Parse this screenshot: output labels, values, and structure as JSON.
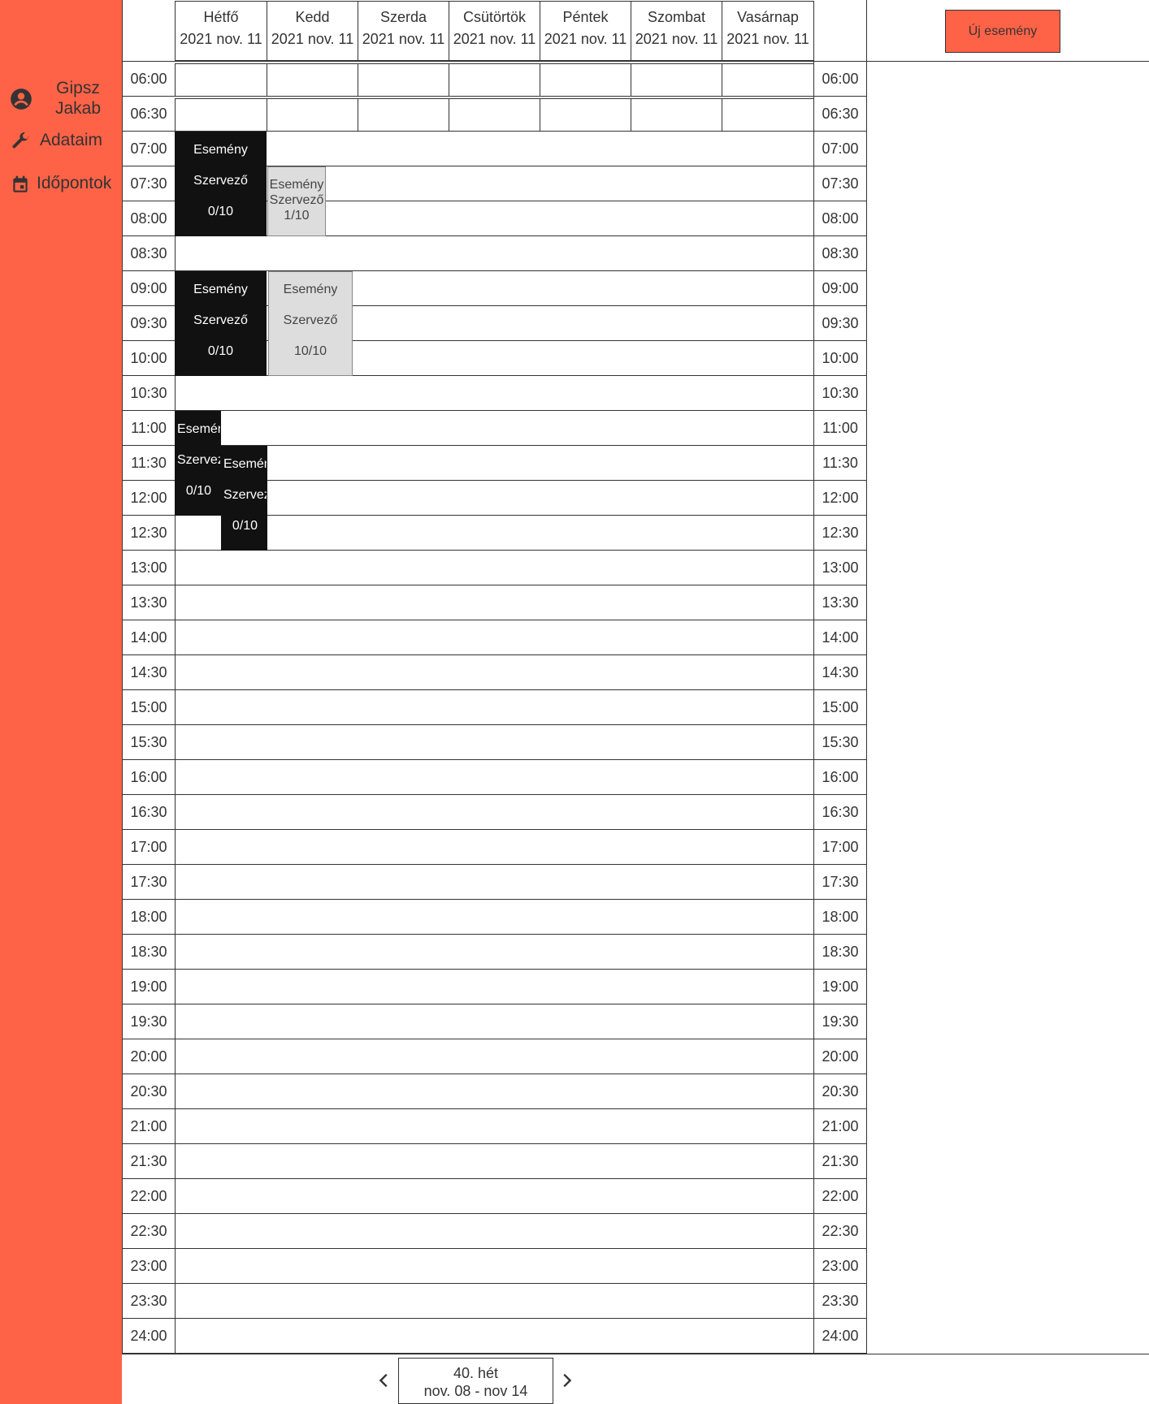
{
  "sidebar": {
    "user_name": "Gipsz Jakab",
    "user_icon": "account-circle-icon",
    "links": [
      {
        "label": "Adataim",
        "icon": "wrench-icon"
      },
      {
        "label": "Időpontok",
        "icon": "calendar-icon"
      }
    ]
  },
  "header": {
    "new_event_label": "Új esemény"
  },
  "days": [
    {
      "name": "Hétfő",
      "date": "2021 nov. 11"
    },
    {
      "name": "Kedd",
      "date": "2021 nov. 11"
    },
    {
      "name": "Szerda",
      "date": "2021 nov. 11"
    },
    {
      "name": "Csütörtök",
      "date": "2021 nov. 11"
    },
    {
      "name": "Péntek",
      "date": "2021 nov. 11"
    },
    {
      "name": "Szombat",
      "date": "2021 nov. 11"
    },
    {
      "name": "Vasárnap",
      "date": "2021 nov. 11"
    }
  ],
  "times": [
    "06:00",
    "06:30",
    "07:00",
    "07:30",
    "08:00",
    "08:30",
    "09:00",
    "09:30",
    "10:00",
    "10:30",
    "11:00",
    "11:30",
    "12:00",
    "12:30",
    "13:00",
    "13:30",
    "14:00",
    "14:30",
    "15:00",
    "15:30",
    "16:00",
    "16:30",
    "17:00",
    "17:30",
    "18:00",
    "18:30",
    "19:00",
    "19:30",
    "20:00",
    "20:30",
    "21:00",
    "21:30",
    "22:00",
    "22:30",
    "23:00",
    "23:30",
    "24:00"
  ],
  "events": [
    {
      "title": "Esemény",
      "organizer": "Szervező",
      "capacity": "0/10",
      "style": "dark"
    },
    {
      "title": "Esemény",
      "organizer": "Szervező",
      "capacity": "1/10",
      "style": "light"
    },
    {
      "title": "Esemény",
      "organizer": "Szervező",
      "capacity": "0/10",
      "style": "dark"
    },
    {
      "title": "Esemény",
      "organizer": "Szervező",
      "capacity": "10/10",
      "style": "light"
    },
    {
      "title": "Esemény",
      "organizer": "Szervező",
      "capacity": "0/10",
      "style": "dark"
    },
    {
      "title": "Esemény",
      "organizer": "Szervező",
      "capacity": "0/10",
      "style": "dark"
    }
  ],
  "week_nav": {
    "week_label": "40. hét",
    "range_label": "nov. 08 - nov 14",
    "prev_icon": "chevron-left-icon",
    "next_icon": "chevron-right-icon"
  },
  "colors": {
    "accent": "#ff6347",
    "event_dark": "#111111",
    "event_light": "#dddddd"
  }
}
